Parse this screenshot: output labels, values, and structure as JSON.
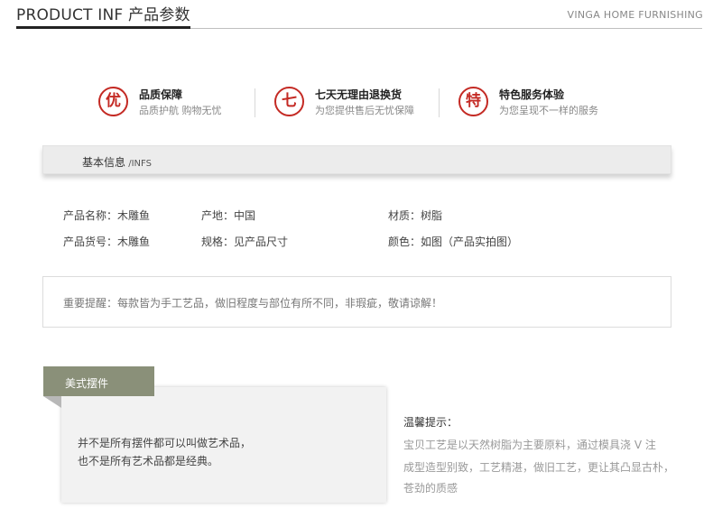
{
  "header": {
    "title": "PRODUCT INF 产品参数",
    "brand": "VINGA HOME FURNISHING"
  },
  "services": [
    {
      "icon": "优",
      "title": "品质保障",
      "subtitle": "品质护航 购物无忧"
    },
    {
      "icon": "七",
      "title": "七天无理由退换货",
      "subtitle": "为您提供售后无忧保障"
    },
    {
      "icon": "特",
      "title": "特色服务体验",
      "subtitle": "为您呈现不一样的服务"
    }
  ],
  "basic_info": {
    "label": "基本信息",
    "label_en": " /INFS"
  },
  "specs": {
    "name": "产品名称：木雕鱼",
    "origin": "产地：中国",
    "material": "材质：树脂",
    "sku": "产品货号：木雕鱼",
    "size": "规格：见产品尺寸",
    "color": "颜色：如图（产品实拍图）"
  },
  "notice": "重要提醒：每款皆为手工艺品，做旧程度与部位有所不同，非瑕疵，敬请谅解！",
  "style_card": {
    "tag": "美式摆件",
    "line1": "并不是所有摆件都可以叫做艺术品，",
    "line2": "也不是所有艺术品都是经典。"
  },
  "tips": {
    "title": "温馨提示：",
    "line1": "宝贝工艺是以天然树脂为主要原料，通过模具浇 V 注",
    "line2": "成型造型别致，工艺精湛，做旧工艺，更让其凸显古朴，",
    "line3": "苍劲的质感"
  },
  "colors": {
    "accent_red": "#c42a24",
    "tag_green": "#8a9079"
  }
}
